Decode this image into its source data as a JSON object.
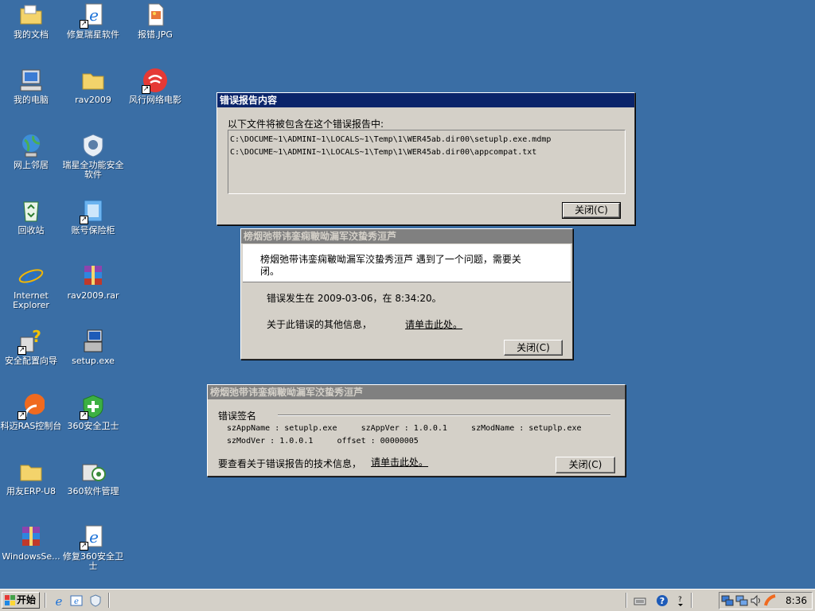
{
  "desktop": {
    "icons": [
      {
        "label": "我的文档",
        "icon": "folder-documents-icon"
      },
      {
        "label": "修复瑞星软件",
        "icon": "ie-shortcut-icon"
      },
      {
        "label": "报错.JPG",
        "icon": "jpg-file-icon"
      },
      {
        "label": "我的电脑",
        "icon": "my-computer-icon"
      },
      {
        "label": "rav2009",
        "icon": "folder-icon"
      },
      {
        "label": "风行网络电影",
        "icon": "funshion-icon"
      },
      {
        "label": "网上邻居",
        "icon": "network-places-icon"
      },
      {
        "label": "瑞星全功能安全软件",
        "icon": "rising-lion-icon"
      },
      {
        "label": "回收站",
        "icon": "recycle-bin-icon"
      },
      {
        "label": "账号保险柜",
        "icon": "account-safe-icon"
      },
      {
        "label": "Internet Explorer",
        "icon": "internet-explorer-icon"
      },
      {
        "label": "rav2009.rar",
        "icon": "winrar-archive-icon"
      },
      {
        "label": "安全配置向导",
        "icon": "security-wizard-icon"
      },
      {
        "label": "setup.exe",
        "icon": "setup-exe-icon"
      },
      {
        "label": "科迈RAS控制台",
        "icon": "ras-console-icon"
      },
      {
        "label": "360安全卫士",
        "icon": "360-safe-icon"
      },
      {
        "label": "用友ERP-U8",
        "icon": "folder-icon"
      },
      {
        "label": "360软件管理",
        "icon": "360-software-manager-icon"
      },
      {
        "label": "WindowsSe...",
        "icon": "winrar-archive-icon"
      },
      {
        "label": "修复360安全卫士",
        "icon": "ie-shortcut-icon"
      }
    ]
  },
  "report_window": {
    "title": "错误报告内容",
    "intro": "以下文件将被包含在这个错误报告中:",
    "files": [
      "C:\\DOCUME~1\\ADMINI~1\\LOCALS~1\\Temp\\1\\WER45ab.dir00\\setuplp.exe.mdmp",
      "C:\\DOCUME~1\\ADMINI~1\\LOCALS~1\\Temp\\1\\WER45ab.dir00\\appcompat.txt"
    ],
    "close_label": "关闭(C)"
  },
  "error_window": {
    "title": "榜烟弛带讳銮痫皸呦漏军洨蛰秀洹芦",
    "message": "榜烟弛带讳銮痫皸呦漏军洨蛰秀洹芦 遇到了一个问题，需要关闭。",
    "occurred": "错误发生在 2009-03-06，在 8:34:20。",
    "more_info": "关于此错误的其他信息，",
    "link": "请单击此处。",
    "close_label": "关闭(C)"
  },
  "signature_window": {
    "title": "榜烟弛带讳銮痫皸呦漏军洨蛰秀洹芦",
    "section": "错误签名",
    "line1": "szAppName : setuplp.exe     szAppVer : 1.0.0.1     szModName : setuplp.exe",
    "line2": "szModVer : 1.0.0.1     offset : 00000005",
    "tech_info": "要查看关于错误报告的技术信息，",
    "link": "请单击此处。",
    "close_label": "关闭(C)"
  },
  "taskbar": {
    "start_label": "开始",
    "clock": "8:36"
  }
}
